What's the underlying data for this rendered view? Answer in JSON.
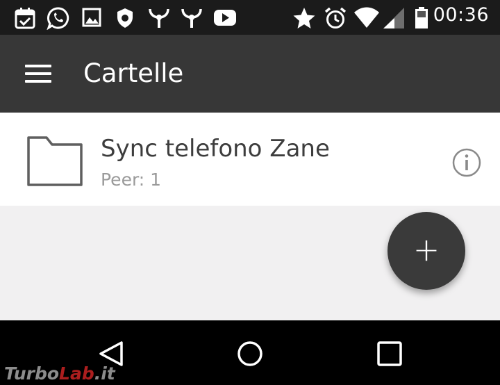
{
  "status_bar": {
    "clock": "00:36",
    "left_icons": [
      "calendar-icon",
      "whatsapp-icon",
      "image-icon",
      "shield-icon",
      "antenna-icon",
      "antenna-icon",
      "youtube-icon"
    ],
    "right_icons": [
      "star-icon",
      "alarm-icon",
      "wifi-icon",
      "signal-icon",
      "battery-icon"
    ]
  },
  "app_bar": {
    "title": "Cartelle"
  },
  "folders": [
    {
      "name": "Sync telefono Zane",
      "peers": "Peer: 1"
    }
  ],
  "fab": {
    "label": "+"
  },
  "watermark": {
    "part1": "Turbo",
    "part2": "Lab",
    "part3": ".it"
  },
  "colors": {
    "status_bar": "#1b1b1b",
    "app_bar": "#373737",
    "background": "#f1f0f1",
    "fab": "#3a3a3a",
    "nav_bar": "#000000"
  }
}
